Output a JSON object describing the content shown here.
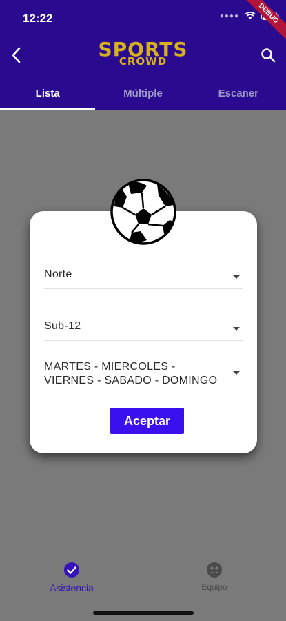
{
  "status": {
    "time": "12:22"
  },
  "debug_banner": "DEBUG",
  "logo": {
    "line1": "SPORTS",
    "line2": "CROWD"
  },
  "tabs": [
    {
      "label": "Lista",
      "active": true
    },
    {
      "label": "Múltiple",
      "active": false
    },
    {
      "label": "Escaner",
      "active": false
    }
  ],
  "dialog": {
    "dropdowns": [
      {
        "value": "Norte"
      },
      {
        "value": "Sub-12"
      },
      {
        "value": "MARTES - MIERCOLES - VIERNES - SABADO - DOMINGO"
      }
    ],
    "accept_label": "Aceptar"
  },
  "bottom_nav": [
    {
      "label": "Asistencia",
      "icon": "check-circle-icon",
      "active": true
    },
    {
      "label": "Equipo",
      "icon": "team-icon",
      "active": false
    }
  ],
  "colors": {
    "appbar": "#2a0b8f",
    "accent": "#3a10ef",
    "overlay": "#7a7a7a",
    "logo": "#d7b01e"
  }
}
